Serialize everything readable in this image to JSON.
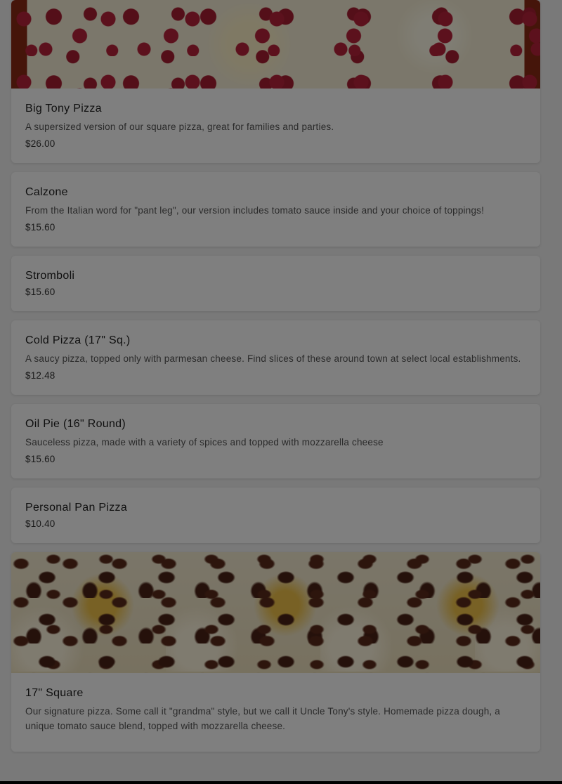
{
  "items": [
    {
      "title": "Big Tony Pizza",
      "description": "A supersized version of our square pizza, great for families and parties.",
      "price": "$26.00"
    },
    {
      "title": "Calzone",
      "description": "From the Italian word for \"pant leg\", our version includes tomato sauce inside and your choice of toppings!",
      "price": "$15.60"
    },
    {
      "title": "Stromboli",
      "price": "$15.60"
    },
    {
      "title": "Cold Pizza (17\" Sq.)",
      "description": "A saucy pizza, topped only with parmesan cheese. Find slices of these around town at select local establishments.",
      "price": "$12.48"
    },
    {
      "title": "Oil Pie (16\" Round)",
      "description": "Sauceless pizza, made with a variety of spices and topped with mozzarella cheese",
      "price": "$15.60"
    },
    {
      "title": "Personal Pan Pizza",
      "price": "$10.40"
    },
    {
      "title": "17\" Square",
      "description": "Our signature pizza. Some call it \"grandma\" style, but we call it Uncle Tony's style. Homemade pizza dough, a unique tomato sauce blend, topped with mozzarella cheese."
    }
  ]
}
